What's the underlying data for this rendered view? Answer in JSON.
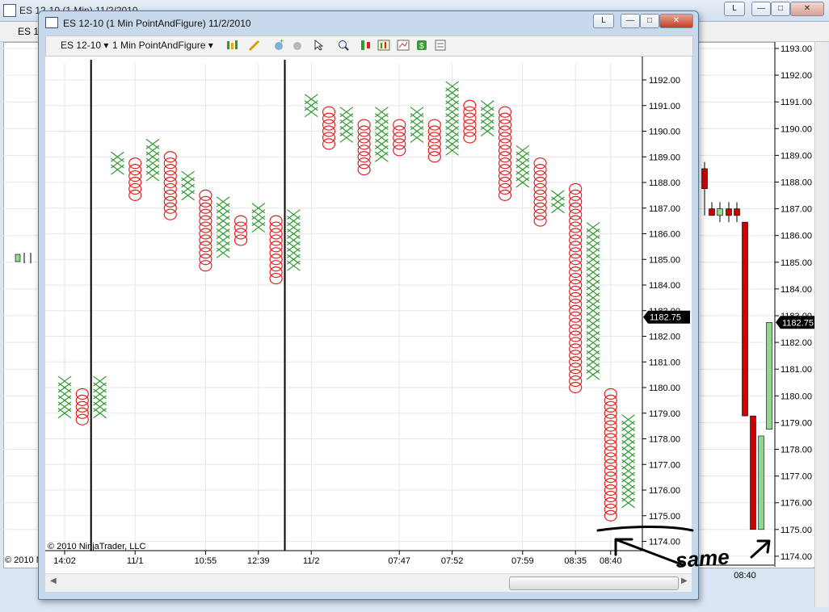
{
  "background_window": {
    "title": "ES 12-10 (1 Min)  11/2/2010",
    "toolbar_label": "ES 12",
    "copyright": "© 2010 N",
    "button_l": "L",
    "price_labels": [
      "1193.00",
      "1192.00",
      "1191.00",
      "1190.00",
      "1189.00",
      "1188.00",
      "1187.00",
      "1186.00",
      "1185.00",
      "1184.00",
      "1183.00",
      "1182.00",
      "1181.00",
      "1180.00",
      "1179.00",
      "1178.00",
      "1177.00",
      "1176.00",
      "1175.00",
      "1174.00"
    ],
    "current_price": "1182.75",
    "time_label": "08:40",
    "candles": [
      {
        "open": 1188.5,
        "close": 1187.75,
        "high": 1188.75,
        "low": 1186.75,
        "dir": "down"
      },
      {
        "open": 1187.0,
        "close": 1186.75,
        "high": 1187.25,
        "low": 1186.75,
        "dir": "down"
      },
      {
        "open": 1186.75,
        "close": 1187.0,
        "high": 1187.25,
        "low": 1186.5,
        "dir": "up"
      },
      {
        "open": 1187.0,
        "close": 1186.75,
        "high": 1187.25,
        "low": 1186.5,
        "dir": "down"
      },
      {
        "open": 1187.0,
        "close": 1186.75,
        "high": 1187.25,
        "low": 1186.5,
        "dir": "down"
      },
      {
        "open": 1186.5,
        "close": 1179.25,
        "high": 1186.5,
        "low": 1179.25,
        "dir": "down"
      },
      {
        "open": 1179.25,
        "close": 1175.0,
        "high": 1179.25,
        "low": 1175.0,
        "dir": "down"
      },
      {
        "open": 1175.0,
        "close": 1178.5,
        "high": 1178.5,
        "low": 1175.0,
        "dir": "up"
      },
      {
        "open": 1178.75,
        "close": 1182.75,
        "high": 1182.75,
        "low": 1178.75,
        "dir": "up"
      }
    ],
    "annotation_text": "same"
  },
  "window": {
    "title": "ES 12-10 (1 Min PointAndFigure)  11/2/2010",
    "button_l": "L",
    "instrument": "ES 12-10",
    "period": "1 Min PointAndFigure",
    "copyright": "© 2010 NinjaTrader, LLC"
  },
  "colors": {
    "x_mark": "#2e9b2e",
    "o_mark": "#e02020",
    "grid": "#e6e6e6",
    "axis": "#000000",
    "bear_candle": "#cc0000",
    "bull_candle": "#90d890",
    "annotation": "#000000"
  },
  "chart_data": {
    "type": "scatter",
    "subtype": "point-and-figure",
    "box_size": 0.25,
    "ylim": [
      1173.75,
      1192.75
    ],
    "y_tick_labels": [
      "1192.00",
      "1191.00",
      "1190.00",
      "1189.00",
      "1188.00",
      "1187.00",
      "1186.00",
      "1185.00",
      "1184.00",
      "1183.00",
      "1182.00",
      "1181.00",
      "1180.00",
      "1179.00",
      "1178.00",
      "1177.00",
      "1176.00",
      "1175.00",
      "1174.00"
    ],
    "x_tick_labels": [
      "14:02",
      "11/1",
      "10:55",
      "12:39",
      "11/2",
      "07:47",
      "07:52",
      "07:59",
      "08:35",
      "08:40"
    ],
    "current_price": "1182.75",
    "session_breaks_after_column": [
      1,
      12
    ],
    "columns": [
      {
        "type": "X",
        "low": 1179.0,
        "high": 1180.25
      },
      {
        "type": "O",
        "low": 1178.75,
        "high": 1179.75
      },
      {
        "type": "X",
        "low": 1179.0,
        "high": 1180.25
      },
      {
        "type": "X",
        "low": 1188.5,
        "high": 1189.0
      },
      {
        "type": "O",
        "low": 1187.5,
        "high": 1188.75
      },
      {
        "type": "X",
        "low": 1188.25,
        "high": 1189.5
      },
      {
        "type": "O",
        "low": 1186.75,
        "high": 1189.0
      },
      {
        "type": "X",
        "low": 1187.5,
        "high": 1188.25
      },
      {
        "type": "O",
        "low": 1184.75,
        "high": 1187.5
      },
      {
        "type": "X",
        "low": 1185.25,
        "high": 1187.25
      },
      {
        "type": "O",
        "low": 1185.75,
        "high": 1186.5
      },
      {
        "type": "X",
        "low": 1186.25,
        "high": 1187.0
      },
      {
        "type": "O",
        "low": 1184.25,
        "high": 1186.5
      },
      {
        "type": "X",
        "low": 1184.75,
        "high": 1186.75
      },
      {
        "type": "X",
        "low": 1190.75,
        "high": 1191.25
      },
      {
        "type": "O",
        "low": 1189.5,
        "high": 1190.75
      },
      {
        "type": "X",
        "low": 1189.75,
        "high": 1190.75
      },
      {
        "type": "O",
        "low": 1188.5,
        "high": 1190.25
      },
      {
        "type": "X",
        "low": 1189.0,
        "high": 1190.75
      },
      {
        "type": "O",
        "low": 1189.25,
        "high": 1190.25
      },
      {
        "type": "X",
        "low": 1189.75,
        "high": 1190.75
      },
      {
        "type": "O",
        "low": 1189.0,
        "high": 1190.25
      },
      {
        "type": "X",
        "low": 1189.25,
        "high": 1191.75
      },
      {
        "type": "O",
        "low": 1189.75,
        "high": 1191.0
      },
      {
        "type": "X",
        "low": 1190.0,
        "high": 1191.0
      },
      {
        "type": "O",
        "low": 1187.5,
        "high": 1190.75
      },
      {
        "type": "X",
        "low": 1188.0,
        "high": 1189.25
      },
      {
        "type": "O",
        "low": 1186.5,
        "high": 1188.75
      },
      {
        "type": "X",
        "low": 1187.0,
        "high": 1187.5
      },
      {
        "type": "O",
        "low": 1180.0,
        "high": 1187.75
      },
      {
        "type": "X",
        "low": 1180.5,
        "high": 1186.25
      },
      {
        "type": "O",
        "low": 1175.0,
        "high": 1179.75
      },
      {
        "type": "X",
        "low": 1175.5,
        "high": 1178.75
      }
    ]
  }
}
